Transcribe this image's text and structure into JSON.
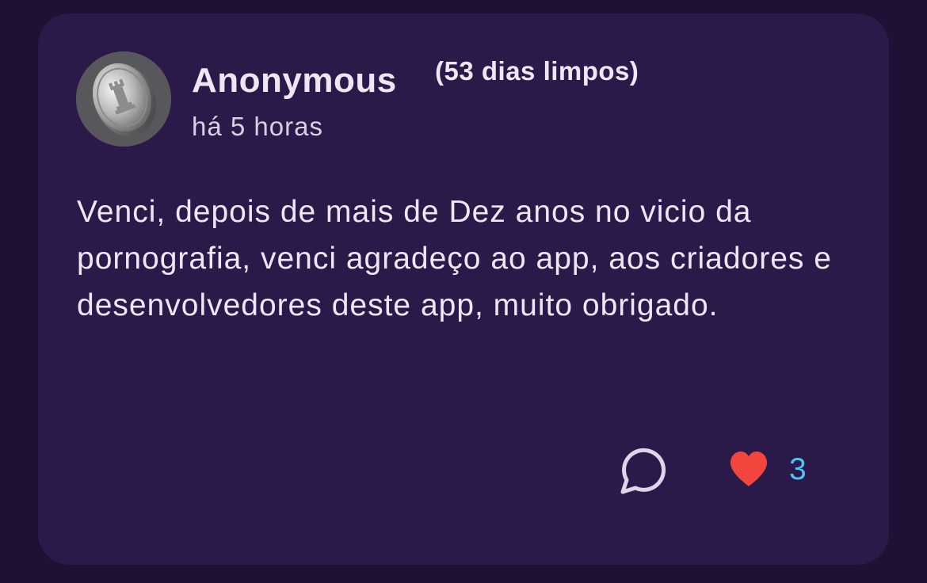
{
  "post": {
    "author": "Anonymous",
    "streak": "(53 dias limpos)",
    "time": "há 5 horas",
    "text": "Venci, depois de mais de Dez anos no vicio da pornografia, venci agradeço ao app, aos criadores e desenvolvedores deste app, muito obrigado.",
    "avatar_icon": "silver-coin-rook-icon",
    "likes": "3"
  },
  "actions": {
    "comment_icon": "comment-bubble-icon",
    "like_icon": "heart-icon"
  },
  "colors": {
    "background": "#1f1034",
    "card": "#2b1949",
    "text": "#ede7f3",
    "heart": "#f2453d",
    "like_count": "#4fc3f7"
  }
}
